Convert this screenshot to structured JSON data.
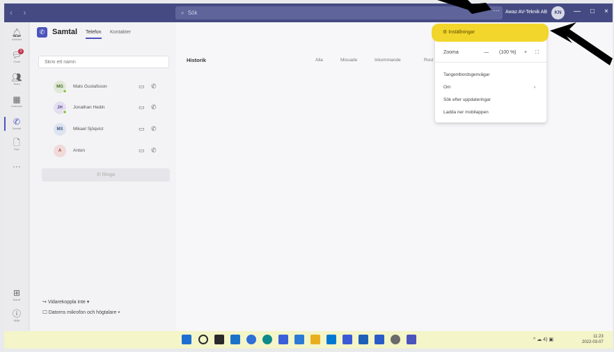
{
  "titlebar": {
    "nav": "‹ ›",
    "search_placeholder": "Sök",
    "more": "···",
    "org": "Awaz AV-Teknik AB",
    "avatar": "KN",
    "minimize": "—",
    "maximize": "□",
    "close": "×"
  },
  "rail": [
    {
      "icon": "bell",
      "label": "Aktivitet"
    },
    {
      "icon": "chat",
      "label": "Chatt",
      "badge": "2"
    },
    {
      "icon": "teams",
      "label": "Team"
    },
    {
      "icon": "calendar",
      "label": "Kalender"
    },
    {
      "icon": "phone",
      "label": "Samtal",
      "active": true
    },
    {
      "icon": "file",
      "label": "Filer"
    },
    {
      "icon": "more",
      "label": "···"
    },
    {
      "icon": "apps",
      "label": "Appar"
    },
    {
      "icon": "help",
      "label": "Hjälp"
    }
  ],
  "calls": {
    "title": "Samtal",
    "tabs": [
      "Telefon",
      "Kontakter"
    ],
    "search_placeholder": "Skriv ett namn",
    "contacts": [
      {
        "initials": "MG",
        "name": "Mats Gustafsson",
        "bg": "#dfe9d6",
        "fg": "#4a6b2e"
      },
      {
        "initials": "JH",
        "name": "Jonathan Hedin",
        "bg": "#e3def0",
        "fg": "#5b4a8f"
      },
      {
        "initials": "MS",
        "name": "Mikael Sjöqvist",
        "bg": "#dde3ef",
        "fg": "#3f5585"
      },
      {
        "initials": "A",
        "name": "Anton",
        "bg": "#f1dada",
        "fg": "#9b3b3b"
      }
    ],
    "add_button": "Ringa",
    "forward": "Vidarekoppla inte",
    "devices": "Datorns mikrofon och högtalare"
  },
  "main": {
    "history_label": "Historik",
    "filters": [
      "Alla",
      "Missade",
      "Inkommande",
      "Rost"
    ]
  },
  "menu": {
    "settings": "Inställningar",
    "zoom_label": "Zooma",
    "zoom_minus": "—",
    "zoom_value": "(100 %)",
    "zoom_plus": "+",
    "items": [
      "Tangentbordsgenvägar",
      "Om",
      "Sök efter uppdateringar",
      "Ladda ner mobilappen"
    ],
    "about_chevron": "›"
  },
  "taskbar": {
    "tray": "^ ☁ 4) ▣",
    "time": "11:23",
    "date": "2022-03-07",
    "icon_colors": [
      "#1e6fd1",
      "#2a2a2a",
      "#2a2a2a",
      "#1a73c9",
      "#2e6fd8",
      "#0f8a8a",
      "#3a5fd9",
      "#2b7bd6",
      "#1c62c5",
      "#0078d4",
      "#3b5bd6",
      "#1f5fb8",
      "#2a5cc8",
      "#6b6b6b",
      "#4b53bc"
    ]
  }
}
